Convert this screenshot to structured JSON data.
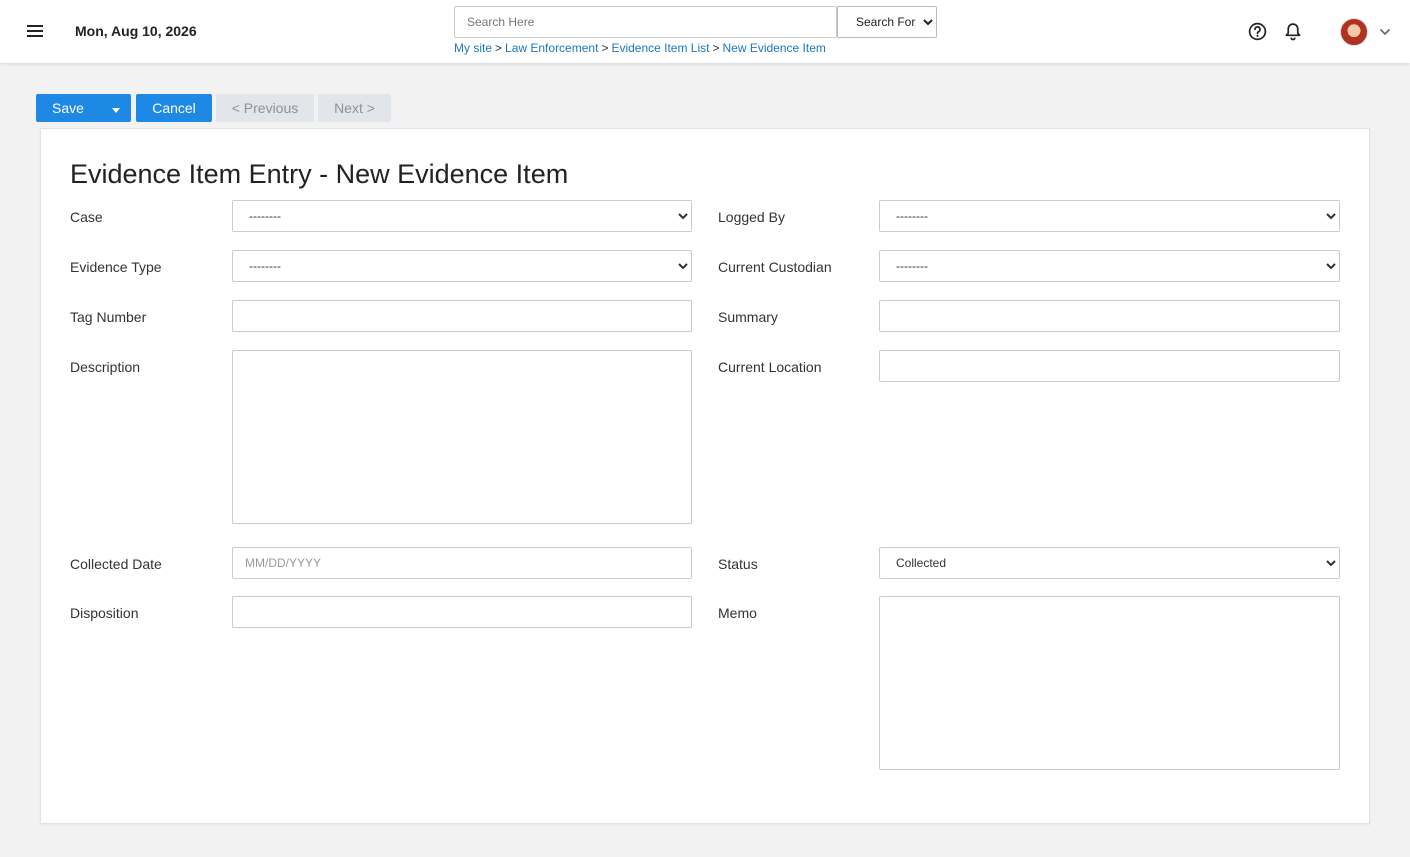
{
  "header": {
    "date": "Mon, Aug 10, 2026",
    "search_placeholder": "Search Here",
    "search_for": "Search For...",
    "breadcrumb": [
      "My site",
      "Law Enforcement",
      "Evidence Item List",
      "New Evidence Item"
    ],
    "breadcrumb_separator": ">"
  },
  "toolbar": {
    "save_label": "Save",
    "cancel_label": "Cancel",
    "previous_label": "< Previous",
    "next_label": "Next >"
  },
  "form": {
    "title": "Evidence Item Entry - New Evidence Item",
    "empty_option": "--------",
    "fields": {
      "case": {
        "label": "Case",
        "value": "--------"
      },
      "logged_by": {
        "label": "Logged By",
        "value": "--------"
      },
      "evidence_type": {
        "label": "Evidence Type",
        "value": "--------"
      },
      "current_custodian": {
        "label": "Current Custodian",
        "value": "--------"
      },
      "tag_number": {
        "label": "Tag Number",
        "value": ""
      },
      "summary": {
        "label": "Summary",
        "value": ""
      },
      "description": {
        "label": "Description",
        "value": ""
      },
      "current_location": {
        "label": "Current Location",
        "value": ""
      },
      "collected_date": {
        "label": "Collected Date",
        "placeholder": "MM/DD/YYYY",
        "value": ""
      },
      "status": {
        "label": "Status",
        "value": "Collected"
      },
      "disposition": {
        "label": "Disposition",
        "value": ""
      },
      "memo": {
        "label": "Memo",
        "value": ""
      }
    }
  },
  "colors": {
    "primary": "#1e88e5",
    "link": "#1b77c5",
    "disabled_bg": "#e2e5e9",
    "page_bg": "#f2f2f2"
  },
  "icons": [
    "menu-icon",
    "help-icon",
    "bell-icon",
    "chevron-down-icon"
  ]
}
